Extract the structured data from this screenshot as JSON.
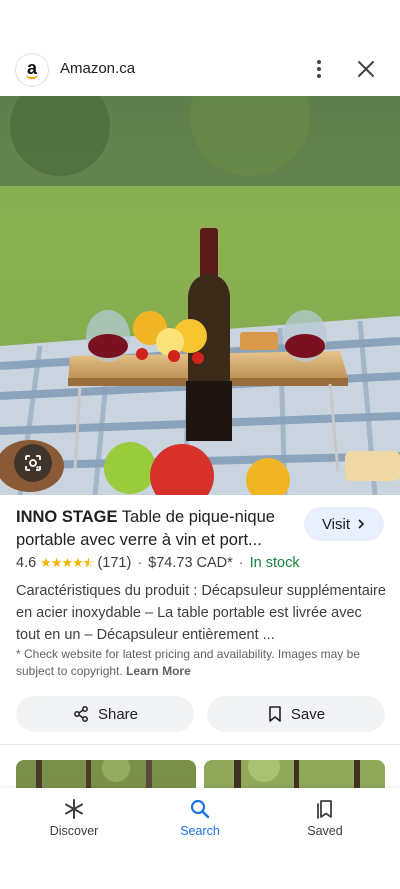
{
  "header": {
    "site_name": "Amazon.ca",
    "logo_letter": "a",
    "icons": {
      "menu": "more-vert-icon",
      "close": "close-icon"
    }
  },
  "hero": {
    "image_icon": "google-lens-icon"
  },
  "product": {
    "title_brand": "INNO STAGE",
    "title_rest": "Table de pique-nique portable avec verre à vin et port...",
    "visit_label": "Visit",
    "rating": "4.6",
    "stars": 4.6,
    "reviews": "(171)",
    "price": "$74.73 CAD*",
    "stock": "In stock",
    "description": "Caractéristiques du produit : Décapsuleur supplémentaire en acier inoxydable – La table portable est livrée avec tout en un – Décapsuleur entièrement ...",
    "note": "* Check website for latest pricing and availability. Images may be subject to copyright.",
    "learn_more": "Learn More"
  },
  "actions": {
    "share_label": "Share",
    "save_label": "Save"
  },
  "bottom_nav": {
    "items": [
      {
        "label": "Discover",
        "icon": "asterisk-icon"
      },
      {
        "label": "Search",
        "icon": "search-icon",
        "active": true
      },
      {
        "label": "Saved",
        "icon": "bookmarks-icon"
      }
    ]
  },
  "colors": {
    "accent": "#1a73e8",
    "stock_green": "#188038",
    "star": "#f4b400",
    "visit_bg": "#e8f0fe"
  }
}
